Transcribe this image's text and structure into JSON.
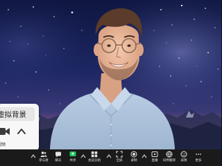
{
  "video": {
    "background": "starry-night-sky-with-mountains",
    "participant": "person-with-glasses-smiling"
  },
  "popup": {
    "virtual_background_label": "虚拟背景",
    "sub_label": "视频"
  },
  "toolbar": {
    "buttons": [
      {
        "label": "参与者",
        "icon": "participants-icon"
      },
      {
        "label": "聊天",
        "icon": "chat-icon"
      },
      {
        "label": "共享",
        "icon": "share-screen-icon"
      },
      {
        "label": "会议分组",
        "icon": "breakout-rooms-icon"
      },
      {
        "label": "全屏",
        "icon": "fullscreen-icon"
      },
      {
        "label": "录制",
        "icon": "record-icon"
      },
      {
        "label": "直播",
        "icon": "live-stream-icon"
      },
      {
        "label": "同传翻译",
        "icon": "interpretation-icon"
      },
      {
        "label": "表情",
        "icon": "reactions-icon"
      },
      {
        "label": "更多",
        "icon": "more-icon"
      }
    ]
  },
  "colors": {
    "toolbar_bg": "#1a1a1a",
    "share_accent": "#22c55e",
    "popup_bg": "#f7f7f7",
    "popup_selected": "#e6e6e6"
  }
}
